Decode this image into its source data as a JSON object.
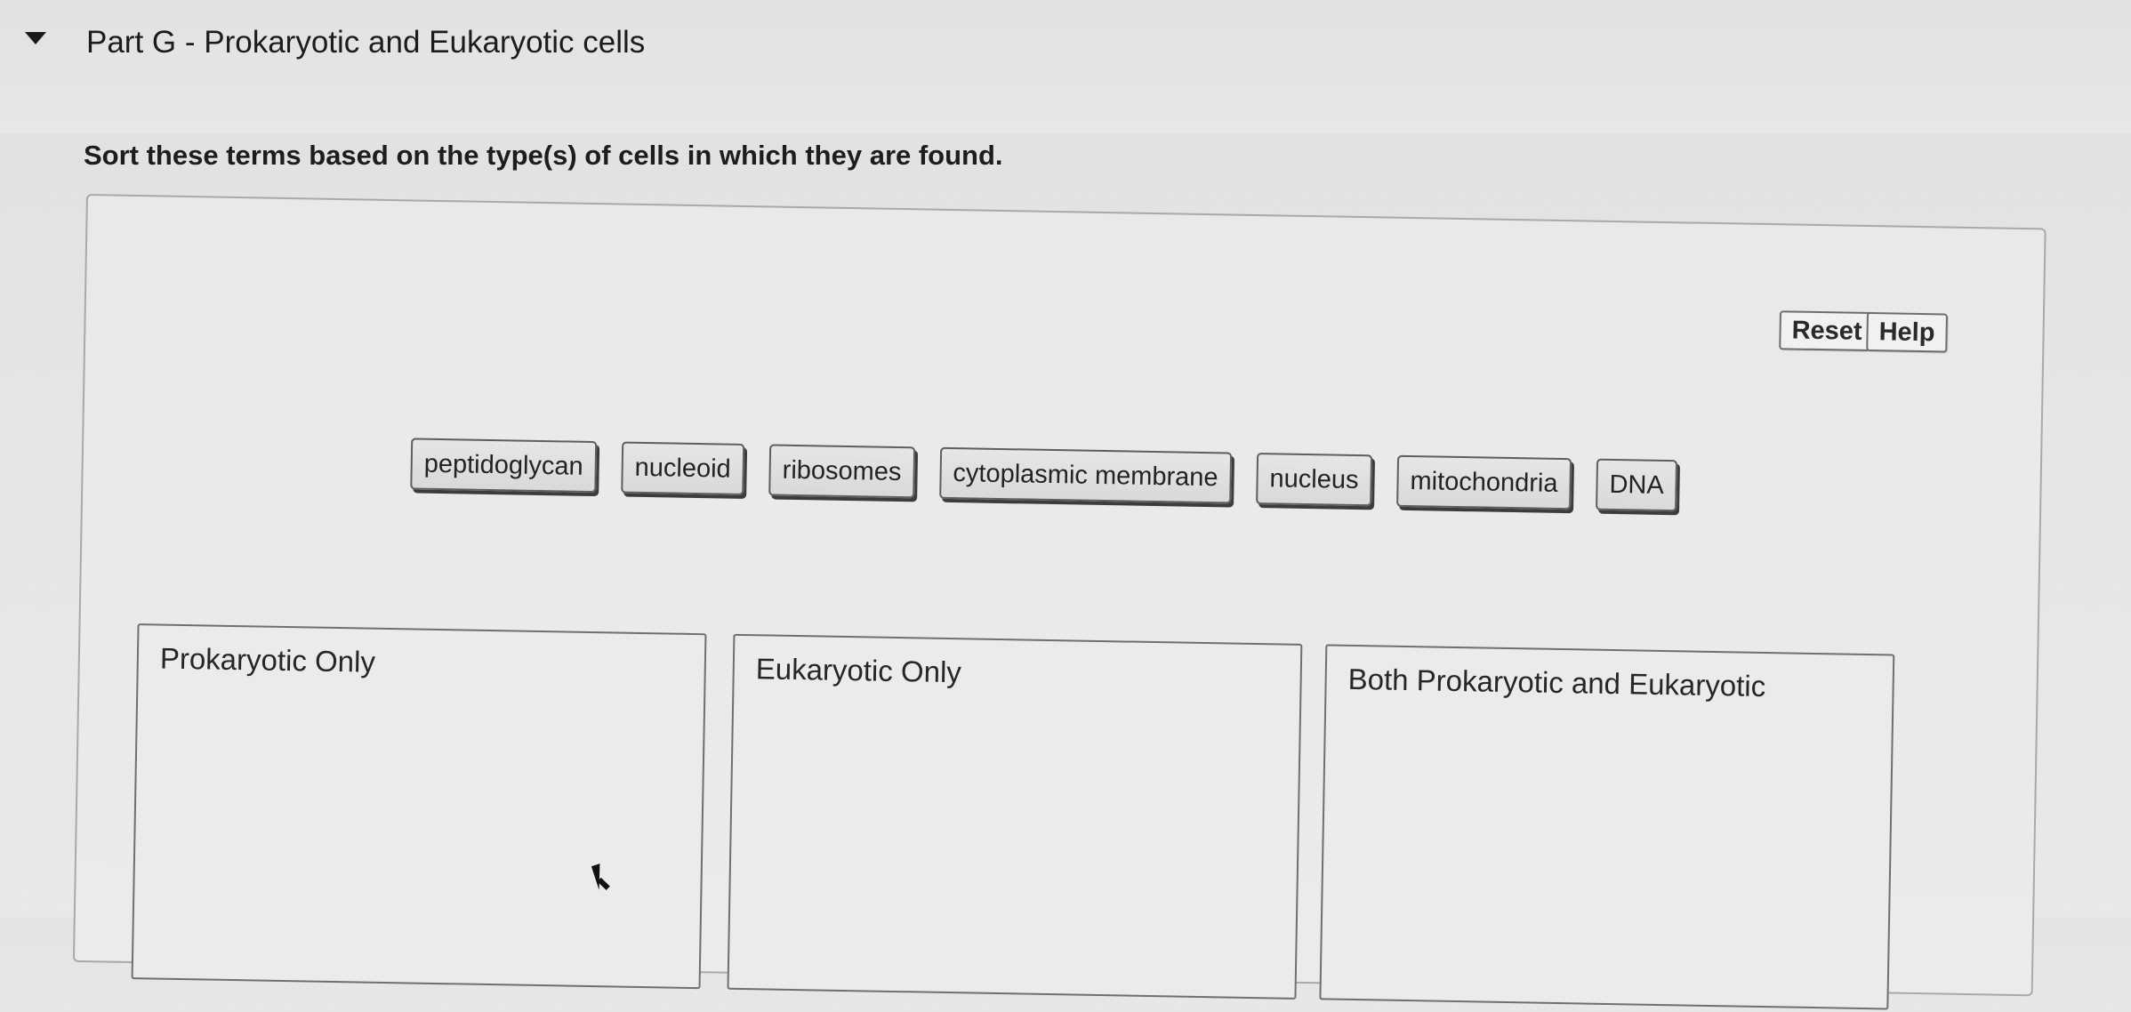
{
  "part": {
    "title": "Part G - Prokaryotic and Eukaryotic cells"
  },
  "instructions": "Sort these terms based on the type(s) of cells in which they are found.",
  "toolbar": {
    "reset_label": "Reset",
    "help_label": "Help"
  },
  "terms": [
    "peptidoglycan",
    "nucleoid",
    "ribosomes",
    "cytoplasmic membrane",
    "nucleus",
    "mitochondria",
    "DNA"
  ],
  "targets": {
    "prokaryotic_only": "Prokaryotic Only",
    "eukaryotic_only": "Eukaryotic Only",
    "both": "Both Prokaryotic and Eukaryotic"
  },
  "icons": {
    "collapse": "caret-down-icon",
    "cursor": "mouse-pointer-icon"
  }
}
